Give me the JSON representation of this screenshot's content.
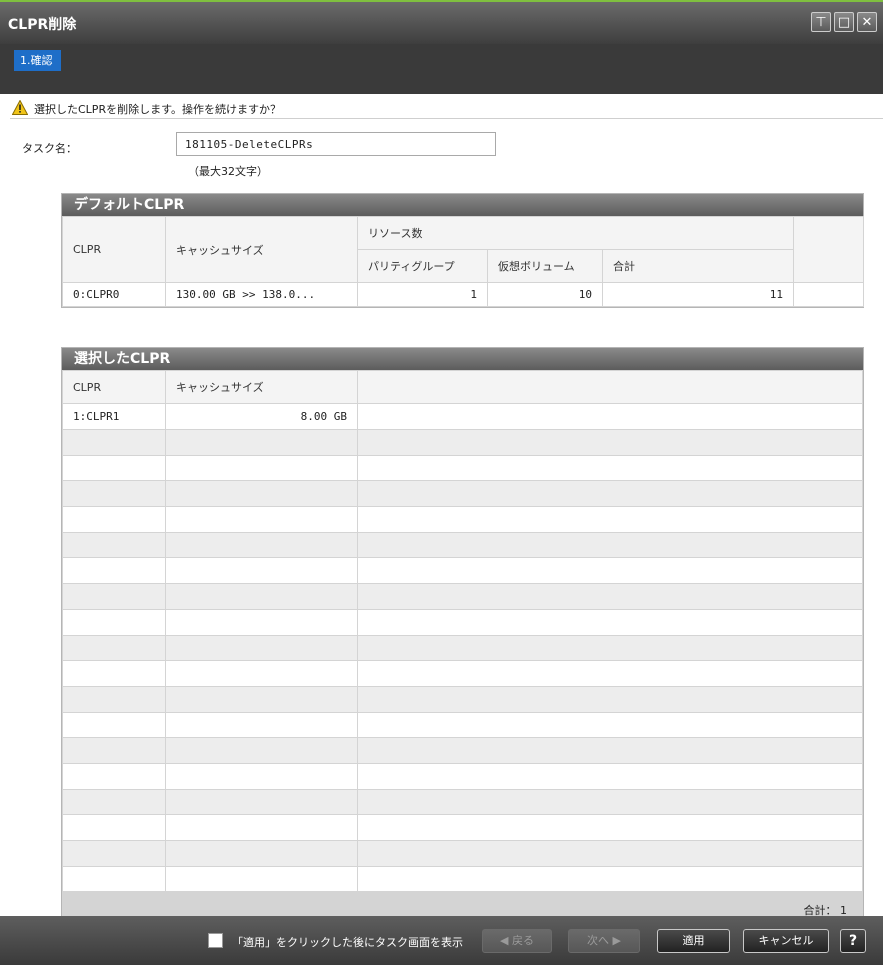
{
  "window": {
    "title": "CLPR削除"
  },
  "steps": [
    {
      "label": "1.確認"
    }
  ],
  "warning": {
    "message": "選択したCLPRを削除します。操作を続けますか？"
  },
  "task": {
    "label": "タスク名：",
    "value": "181105-DeleteCLPRs",
    "hint": "（最大32文字）"
  },
  "default_clpr": {
    "title": "デフォルトCLPR",
    "headers": {
      "clpr": "CLPR",
      "cache": "キャッシュサイズ",
      "resources": "リソース数",
      "parity": "パリティグループ",
      "vvol": "仮想ボリューム",
      "total": "合計"
    },
    "row": {
      "clpr": "0:CLPR0",
      "cache": "130.00 GB >> 138.0...",
      "parity": "1",
      "vvol": "10",
      "total": "11"
    }
  },
  "selected_clpr": {
    "title": "選択したCLPR",
    "headers": {
      "clpr": "CLPR",
      "cache": "キャッシュサイズ"
    },
    "rows": [
      {
        "clpr": "1:CLPR1",
        "cache": "8.00 GB"
      }
    ],
    "total": "合計： 1"
  },
  "footer": {
    "checkbox_label": "「適用」をクリックした後にタスク画面を表示",
    "checkbox_checked": false,
    "back": "◀ 戻る",
    "next": "次へ ▶",
    "apply": "適用",
    "cancel": "キャンセル",
    "help": "?"
  },
  "colors": {
    "accent": "#1e6ec8",
    "title_border": "#7fbf3f",
    "warning": "#f0c419"
  }
}
